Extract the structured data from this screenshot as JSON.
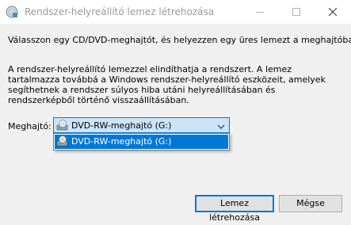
{
  "window": {
    "title": "Rendszer-helyreállító lemez létrehozása",
    "icon": "system-repair-disc-icon",
    "controls": [
      "minimize-icon",
      "maximize-icon",
      "close-icon"
    ]
  },
  "main": {
    "instruction": "Válasszon egy CD/DVD-meghajtót, és helyezzen egy üres lemezt a meghajtóba.",
    "description": "A rendszer-helyreállító lemezzel elindíthatja a rendszert. A lemez tartalmazza továbbá a Windows rendszer-helyreállító eszközeit, amelyek segíthetnek a rendszer súlyos hiba utáni helyreállításában és rendszerképből történő visszaállításában."
  },
  "drive": {
    "label": "Meghajtó:",
    "selected": "DVD-RW-meghajtó (G:)",
    "options": [
      "DVD-RW-meghajtó (G:)"
    ]
  },
  "buttons": {
    "create": "Lemez létrehozása",
    "cancel": "Mégse"
  },
  "colors": {
    "accent": "#0078d7",
    "selection_bg": "#cce4f7",
    "window_bg": "#f0f0f0",
    "title_text": "#9a9a9a"
  }
}
